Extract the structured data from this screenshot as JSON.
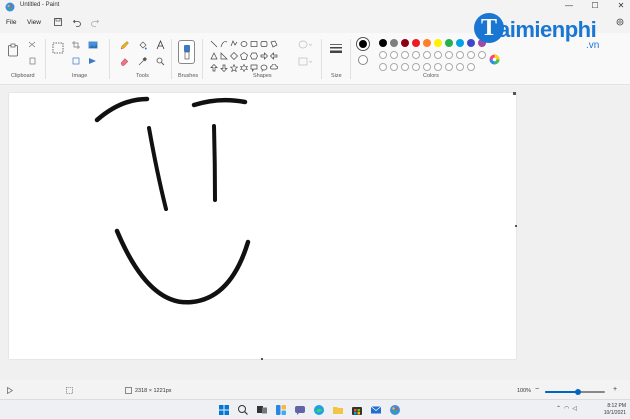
{
  "window": {
    "title": "Untitled - Paint",
    "controls": [
      "—",
      "☐",
      "✕"
    ]
  },
  "menu": {
    "file": "File",
    "view": "View"
  },
  "ribbon": {
    "groups": {
      "clipboard": "Clipboard",
      "image": "Image",
      "tools": "Tools",
      "brushes": "Brushes",
      "shapes": "Shapes",
      "size": "Size",
      "colors": "Colors"
    },
    "palette_row1": [
      "#000000",
      "#7f7f7f",
      "#880015",
      "#ed1c24",
      "#ff7f27",
      "#fff200",
      "#22b14c",
      "#00a2e8",
      "#3f48cc",
      "#a349a4"
    ],
    "palette_row2": [
      "#ffffff",
      "#c3c3c3",
      "#b97a57",
      "#ffaec9",
      "#ffc90e",
      "#efe4b0",
      "#b5e61d",
      "#99d9ea",
      "#7092be",
      "#c8bfe7"
    ],
    "color1": "#000000",
    "color2": "#ffffff"
  },
  "statusbar": {
    "canvas_size": "2318 × 1221px",
    "zoom": "100%",
    "zoom_fraction": 0.55
  },
  "taskbar": {
    "time": "8:12 PM",
    "date": "10/1/2021"
  },
  "watermark": {
    "logo_letter": "T",
    "brand": "aimienphi",
    "suffix": ".vn"
  }
}
